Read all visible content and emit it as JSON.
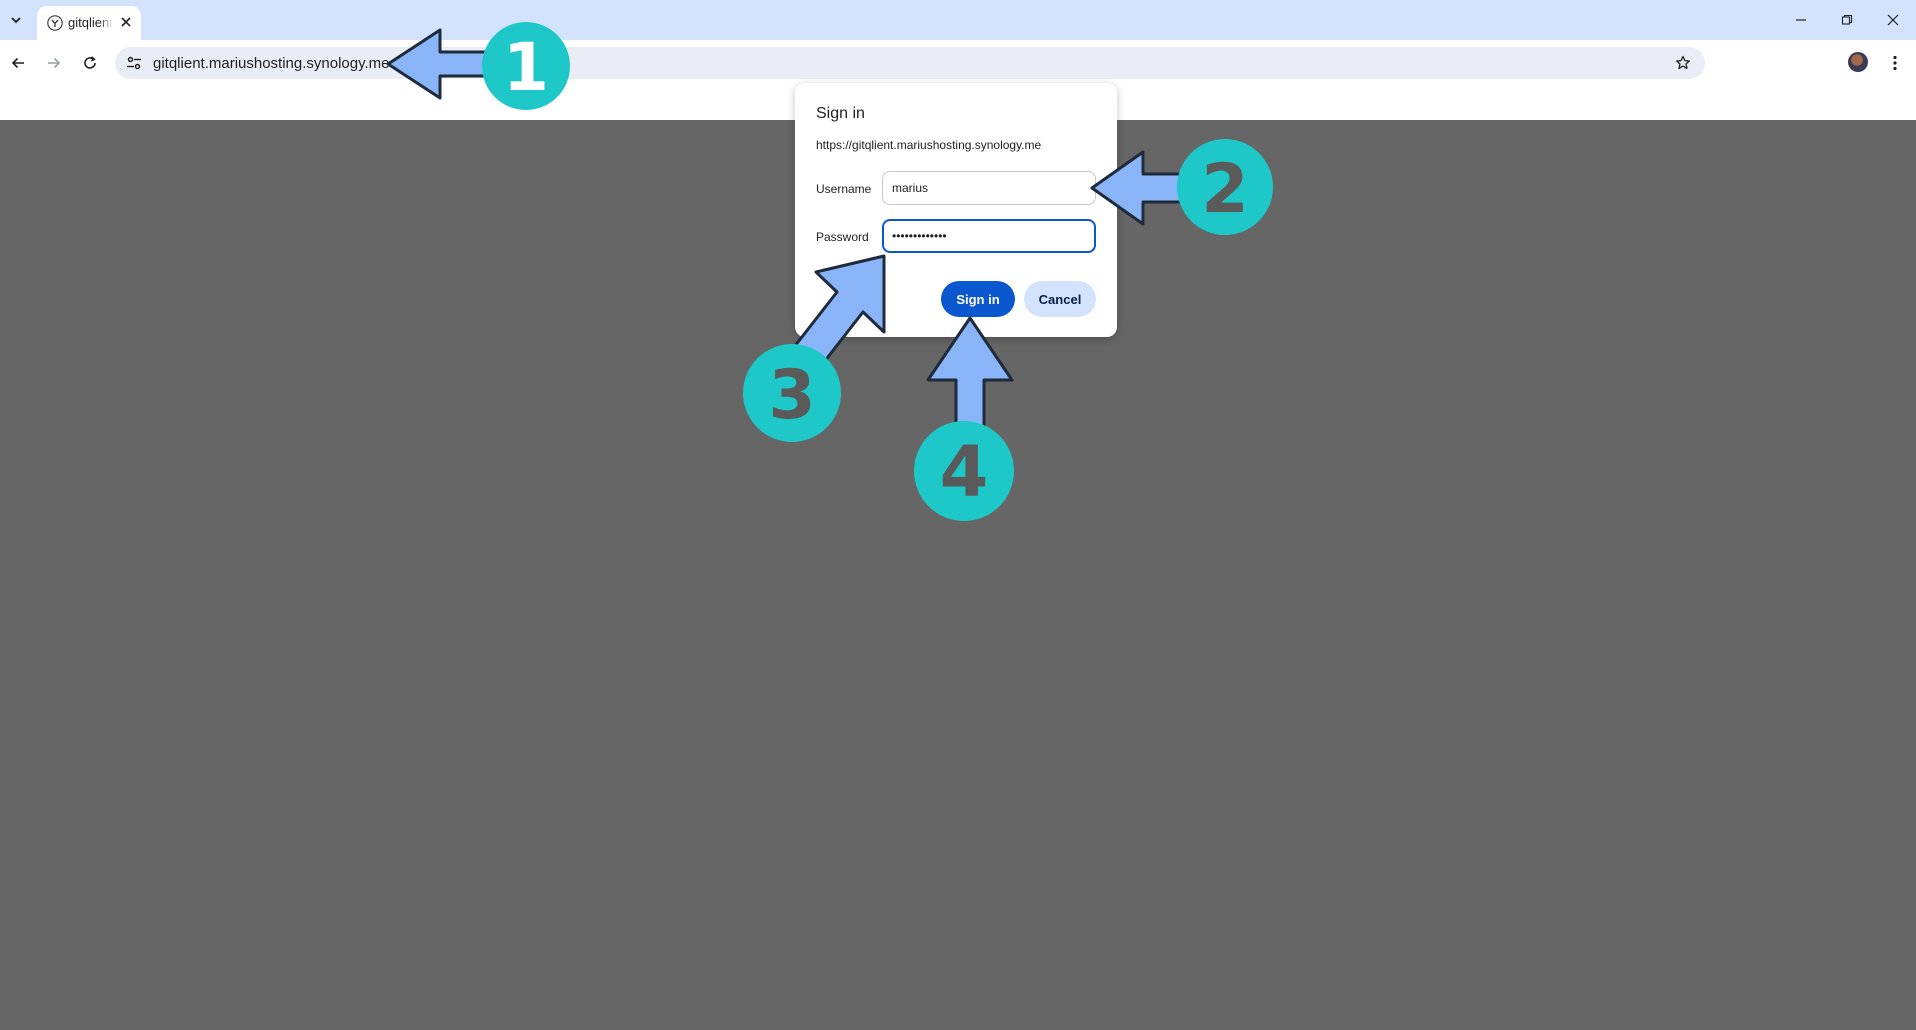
{
  "browser": {
    "tab": {
      "title": "gitqlient.mariushosting.synology.me"
    },
    "address_bar": {
      "url": "gitqlient.mariushosting.synology.me"
    }
  },
  "dialog": {
    "title": "Sign in",
    "origin": "https://gitqlient.mariushosting.synology.me",
    "username_label": "Username",
    "username_value": "marius",
    "password_label": "Password",
    "password_value": "•••••••••••••",
    "sign_in_button": "Sign in",
    "cancel_button": "Cancel"
  },
  "annotations": {
    "callouts": [
      "1",
      "2",
      "3",
      "4"
    ],
    "arrow_color": "#8ab4f8",
    "circle_color": "#1fc8c8",
    "number_colors": [
      "#ffffff",
      "#5a5a5a",
      "#5a5a5a",
      "#5a5a5a"
    ]
  }
}
